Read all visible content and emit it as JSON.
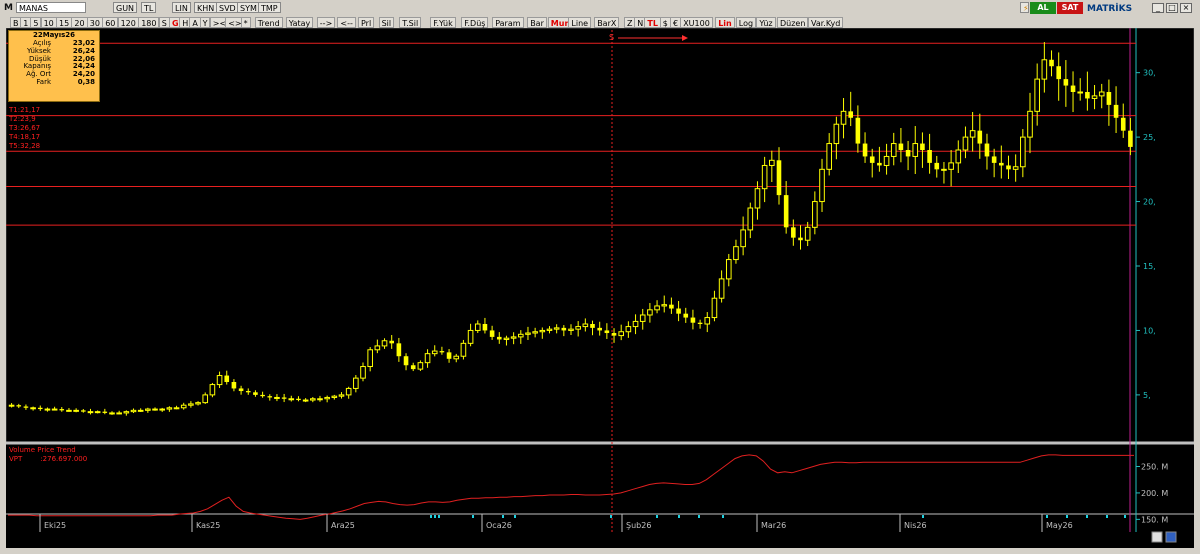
{
  "window": {
    "logo": "M",
    "symbol": "MANAS",
    "tabs": [
      "GUN",
      "TL",
      "LIN",
      "KHN",
      "SVD",
      "SYM",
      "TMP"
    ],
    "brand": "MATRİKS",
    "al": "AL",
    "sat": "SAT"
  },
  "toolbar": {
    "items": [
      "B",
      "1",
      "5",
      "10",
      "15",
      "20",
      "30",
      "60",
      "120",
      "180",
      "S",
      "G",
      "H",
      "A",
      "Y",
      "><",
      "<>",
      "*",
      "Trend",
      "Yatay",
      "-->",
      "<--",
      "Prl",
      "Sil",
      "T.Sil",
      "F.Yük",
      "F.Düş",
      "Param",
      "Bar",
      "Mum",
      "Line",
      "BarX",
      "Z",
      "N",
      "TL",
      "$",
      "€",
      "XU100",
      "Lin",
      "Log",
      "Yüz",
      "Düzen",
      "Var.Kyd"
    ],
    "active_items": [
      "G",
      "Mum",
      "TL",
      "Lin"
    ]
  },
  "infobox": {
    "date": "22Mayıs26",
    "rows": [
      {
        "k": "Açılış",
        "v": "23,02"
      },
      {
        "k": "Yüksek",
        "v": "26,24"
      },
      {
        "k": "Düşük",
        "v": "22,06"
      },
      {
        "k": "Kapanış",
        "v": "24,24"
      },
      {
        "k": "Ağ. Ort",
        "v": "24,20"
      },
      {
        "k": "Fark",
        "v": "0,38"
      }
    ]
  },
  "tlines": [
    "T1:21,17",
    "T2:23,9",
    "T3:26,67",
    "T4:18,17",
    "T5:32,28"
  ],
  "indicator": {
    "name": "Volume Price Trend",
    "label": "VPT",
    "value": ":276.697.000"
  },
  "colors": {
    "background": "#000000",
    "candle": "#ffff00",
    "hline": "#e82020",
    "axis": "#20c0c0",
    "vpt": "#e02020",
    "marker": "#c02090"
  },
  "chart_data": {
    "type": "candlestick",
    "price_axis": {
      "ticks": [
        "5,",
        "10,",
        "15,",
        "20,",
        "25,",
        "30,"
      ],
      "range": [
        1.5,
        33
      ]
    },
    "vpt_axis": {
      "ticks": [
        "150. M",
        "200. M",
        "250. M"
      ],
      "range": [
        145,
        285
      ]
    },
    "x_labels": [
      "Eki25",
      "Kas25",
      "Ara25",
      "Oca26",
      "Şub26",
      "Mar26",
      "Nis26",
      "May26"
    ],
    "horizontal_levels": [
      21.17,
      23.9,
      26.67,
      18.17,
      32.28
    ],
    "signal_marker": "S",
    "close_series": [
      4.2,
      4.1,
      4.0,
      4.0,
      3.9,
      3.9,
      3.9,
      3.8,
      3.8,
      3.8,
      3.7,
      3.7,
      3.7,
      3.6,
      3.6,
      3.6,
      3.7,
      3.8,
      3.8,
      3.9,
      3.9,
      3.9,
      4.0,
      4.0,
      4.2,
      4.3,
      4.4,
      5.0,
      5.8,
      6.5,
      6.0,
      5.5,
      5.3,
      5.2,
      5.0,
      4.9,
      4.8,
      4.8,
      4.7,
      4.7,
      4.6,
      4.6,
      4.7,
      4.7,
      4.8,
      4.9,
      5.0,
      5.5,
      6.3,
      7.2,
      8.5,
      8.8,
      9.2,
      9.0,
      8.0,
      7.3,
      7.0,
      7.5,
      8.2,
      8.4,
      8.3,
      7.8,
      8.0,
      9.0,
      10.0,
      10.5,
      10.0,
      9.5,
      9.3,
      9.4,
      9.5,
      9.7,
      9.8,
      9.9,
      10.0,
      10.1,
      10.2,
      10.0,
      10.1,
      10.3,
      10.5,
      10.2,
      10.0,
      9.8,
      9.6,
      9.9,
      10.3,
      10.7,
      11.2,
      11.6,
      11.9,
      12.0,
      11.7,
      11.3,
      11.0,
      10.6,
      10.5,
      11.0,
      12.5,
      14.0,
      15.5,
      16.5,
      17.8,
      19.5,
      21.0,
      22.8,
      23.2,
      20.5,
      18.0,
      17.2,
      17.0,
      18.0,
      20.0,
      22.5,
      24.5,
      26.0,
      27.0,
      26.5,
      24.5,
      23.5,
      23.0,
      22.8,
      23.5,
      24.5,
      24.0,
      23.5,
      24.5,
      24.0,
      23.0,
      22.5,
      22.5,
      23.0,
      24.0,
      25.0,
      25.5,
      24.5,
      23.5,
      23.0,
      22.8,
      22.5,
      22.7,
      25.0,
      27.0,
      29.5,
      31.0,
      30.5,
      29.5,
      29.0,
      28.5,
      28.5,
      28.0,
      28.2,
      28.5,
      27.5,
      26.5,
      25.5,
      24.24
    ],
    "vpt_series": [
      158,
      158,
      158,
      158,
      157,
      157,
      157,
      157,
      157,
      157,
      157,
      157,
      157,
      157,
      157,
      157,
      157,
      157,
      157,
      157,
      157,
      158,
      158,
      158,
      160,
      161,
      162,
      165,
      170,
      178,
      186,
      192,
      175,
      165,
      162,
      160,
      158,
      156,
      154,
      152,
      151,
      150,
      152,
      155,
      158,
      160,
      163,
      166,
      170,
      175,
      180,
      182,
      184,
      183,
      180,
      178,
      177,
      178,
      181,
      183,
      183,
      182,
      183,
      186,
      188,
      190,
      190,
      191,
      191,
      192,
      192,
      193,
      193,
      194,
      195,
      195,
      196,
      196,
      196,
      197,
      197,
      196,
      196,
      196,
      197,
      198,
      200,
      204,
      208,
      212,
      216,
      218,
      219,
      218,
      217,
      216,
      216,
      218,
      225,
      235,
      245,
      255,
      265,
      270,
      272,
      270,
      260,
      245,
      238,
      240,
      238,
      242,
      246,
      250,
      254,
      256,
      258,
      258,
      257,
      257,
      258,
      258,
      258,
      258,
      258,
      258,
      258,
      258,
      258,
      258,
      258,
      258,
      258,
      258,
      258,
      258,
      258,
      258,
      258,
      258,
      258,
      258,
      258,
      262,
      266,
      270,
      272,
      272,
      271,
      271,
      271,
      271,
      271,
      271,
      271,
      271,
      271,
      271,
      271
    ]
  }
}
